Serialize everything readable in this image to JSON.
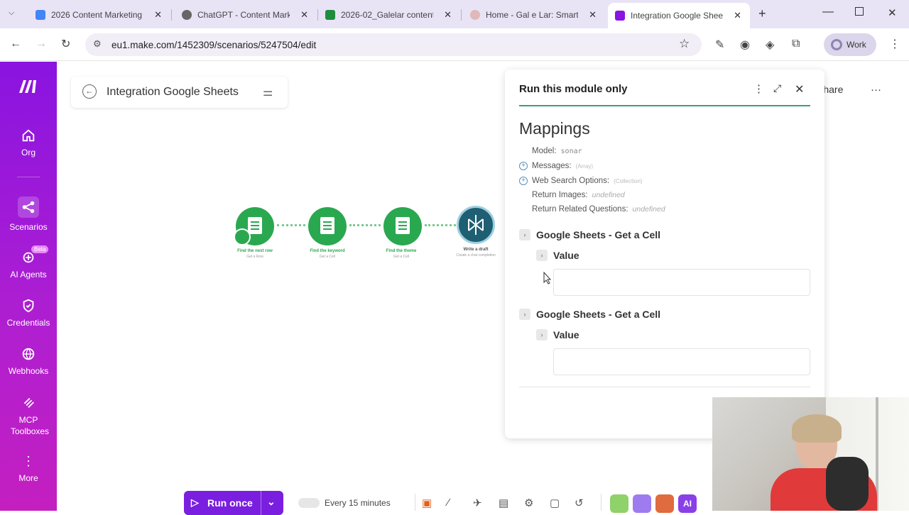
{
  "browser": {
    "tabs": [
      {
        "title": "2026 Content Marketing",
        "favicon_color": "#4285f4"
      },
      {
        "title": "ChatGPT - Content Mark",
        "favicon_color": "#666666"
      },
      {
        "title": "2026-02_Galelar content",
        "favicon_color": "#1e8e3e"
      },
      {
        "title": "Home - Gal e Lar: Smart",
        "favicon_color": "#e0b8b8"
      },
      {
        "title": "Integration Google Shee",
        "favicon_color": "#8a14e0"
      }
    ],
    "url": "eu1.make.com/1452309/scenarios/5247504/edit",
    "profile_label": "Work"
  },
  "sidebar": {
    "items": [
      {
        "label": "Org",
        "icon": "home-icon"
      },
      {
        "label": "Scenarios",
        "icon": "share-nodes-icon"
      },
      {
        "label": "AI Agents",
        "icon": "ai-agent-icon",
        "badge": "Beta"
      },
      {
        "label": "Credentials",
        "icon": "shield-icon"
      },
      {
        "label": "Webhooks",
        "icon": "globe-icon"
      },
      {
        "label": "MCP Toolboxes",
        "icon": "mcp-icon"
      },
      {
        "label": "More",
        "icon": "more-vertical-icon"
      }
    ]
  },
  "scenario": {
    "title": "Integration Google Sheets",
    "share_label": "Share",
    "nodes": [
      {
        "label": "Find the next row",
        "sub": "Get a Row"
      },
      {
        "label": "Find the keyword",
        "sub": "Get a Cell"
      },
      {
        "label": "Find the theme",
        "sub": "Get a Cell"
      },
      {
        "label": "Write a draft",
        "sub": "Create a chat completion"
      }
    ]
  },
  "panel": {
    "title": "Run this module only",
    "heading": "Mappings",
    "fields": [
      {
        "label": "Model:",
        "value": "sonar",
        "kind": "mono"
      },
      {
        "label": "Messages:",
        "value": "(Array)",
        "kind": "small",
        "expandable": true
      },
      {
        "label": "Web Search Options:",
        "value": "(Collection)",
        "kind": "small",
        "expandable": true
      },
      {
        "label": "Return Images:",
        "value": "undefined",
        "kind": "italic"
      },
      {
        "label": "Return Related Questions:",
        "value": "undefined",
        "kind": "italic"
      }
    ],
    "sections": [
      {
        "title": "Google Sheets - Get a Cell",
        "sub": "Value",
        "value": ""
      },
      {
        "title": "Google Sheets - Get a Cell",
        "sub": "Value",
        "value": ""
      }
    ]
  },
  "bottombar": {
    "run_label": "Run once",
    "schedule_label": "Every 15 minutes",
    "ai_label": "AI"
  },
  "colors": {
    "brand": "#8a14e0",
    "sheets_green": "#2aa850",
    "accent_line": "#3a9f7a"
  }
}
